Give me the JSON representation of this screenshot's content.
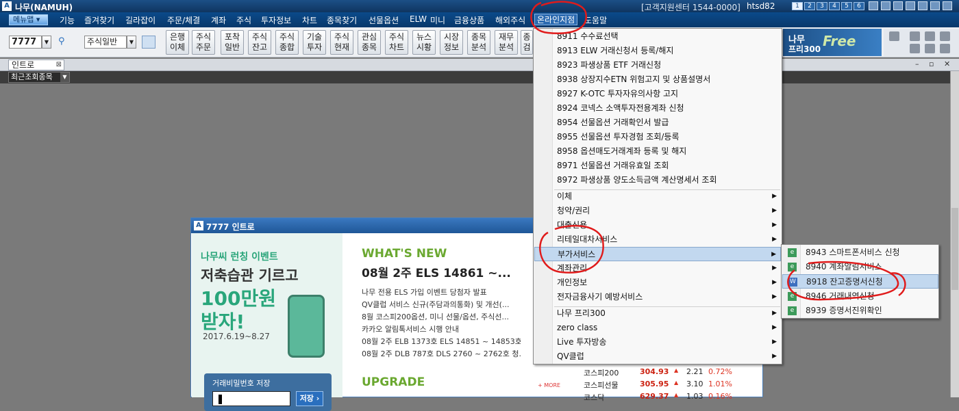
{
  "titlebar": {
    "logo": "A",
    "app": "나무(NAMUH)",
    "support": "[고객지원센터 1544-0000]",
    "user": "htsd82",
    "screens": [
      "1",
      "2",
      "3",
      "4",
      "5",
      "6"
    ]
  },
  "menubar": {
    "menu_btn": "메뉴맵 ▾",
    "items": [
      "기능",
      "즐겨찾기",
      "길라잡이",
      "주문/체결",
      "계좌",
      "주식",
      "투자정보",
      "차트",
      "종목찾기",
      "선물옵션",
      "ELW",
      "미니",
      "금융상품",
      "해외주식",
      "온라인지점",
      "도움말"
    ]
  },
  "toolbar": {
    "code": "7777",
    "combo": "주식일반",
    "buttons": [
      [
        "은행",
        "이체"
      ],
      [
        "주식",
        "주문"
      ],
      [
        "포착",
        "일반"
      ],
      [
        "주식",
        "잔고"
      ],
      [
        "주식",
        "종합"
      ],
      [
        "기술",
        "투자"
      ],
      [
        "주식",
        "현재"
      ],
      [
        "관심",
        "종목"
      ],
      [
        "주식",
        "차트"
      ],
      [
        "뉴스",
        "시황"
      ],
      [
        "시장",
        "정보"
      ],
      [
        "종목",
        "분석"
      ],
      [
        "재무",
        "분석"
      ],
      [
        "종",
        "검"
      ]
    ]
  },
  "promo": {
    "line1": "나무",
    "line2": "프리300",
    "free": "Free"
  },
  "tab": {
    "label": "인트로"
  },
  "recent": {
    "label": "최근조회종목"
  },
  "intro": {
    "title": "7777 인트로",
    "event": {
      "l1": "나무씨 런칭 이벤트",
      "l2": "저축습관 기르고",
      "l3": "100만원",
      "l4": "받자!",
      "date": "2017.6.19~8.27"
    },
    "password": {
      "label": "거래비밀번호 저장",
      "button": "저장 ›"
    },
    "whats_new": "WHAT'S NEW",
    "headline": "08월 2주 ELS 14861 ~...",
    "news": [
      "나무 전용 ELS 가입 이벤트 당첨자 발표",
      "QV클럽 서비스 신규(주담과의통화) 및 개선(...",
      "8월 코스피200옵션, 미니 선물/옵션, 주식선...",
      "카카오 알림톡서비스 시행 안내",
      "08월 2주 ELB 1373호 ELS 14851 ~ 14853호...",
      "08월 2주 DLB 787호 DLS 2760 ~ 2762호 청..."
    ],
    "upgrade": "UPGRADE",
    "more": "+ MORE",
    "market": [
      {
        "name": "코스피200",
        "value": "304.93",
        "arrow": "▲",
        "chg": "2.21",
        "pct": "0.72%"
      },
      {
        "name": "코스피선물",
        "value": "305.95",
        "arrow": "▲",
        "chg": "3.10",
        "pct": "1.01%"
      },
      {
        "name": "코스닥",
        "value": "629.37",
        "arrow": "▲",
        "chg": "1.03",
        "pct": "0.16%"
      }
    ]
  },
  "dropdown": {
    "items": [
      "8911 수수료선택",
      "8913 ELW 거래신청서 등록/해지",
      "8923 파생상품 ETF 거래신청",
      "8938 상장지수ETN 위험고지 및 상품설명서",
      "8927 K-OTC 투자자유의사항 고지",
      "8924 코넥스 소액투자전용계좌 신청",
      "8954 선물옵션 거래확인서 발급",
      "8955 선물옵션 투자경험 조회/등록",
      "8958 옵션매도거래계좌 등록 및 해지",
      "8971 선물옵션 거래유효일 조회",
      "8972 파생상품 양도소득금액 계산명세서 조회"
    ],
    "groups": [
      "이체",
      "청약/권리",
      "대출신용",
      "리테일대차서비스",
      "부가서비스",
      "계좌관리",
      "개인정보",
      "전자금융사기 예방서비스"
    ],
    "groups2": [
      "나무 프리300",
      "zero class",
      "Live 투자방송",
      "QV클럽"
    ],
    "submenu": [
      {
        "icon": "e",
        "label": "8943 스마트폰서비스 신청"
      },
      {
        "icon": "e",
        "label": "8940 계좌알림서비스"
      },
      {
        "icon": "W",
        "label": "8918 잔고증명서신청"
      },
      {
        "icon": "e",
        "label": "8946 거래내역신청"
      },
      {
        "icon": "e",
        "label": "8939 증명서진위확인"
      }
    ]
  }
}
